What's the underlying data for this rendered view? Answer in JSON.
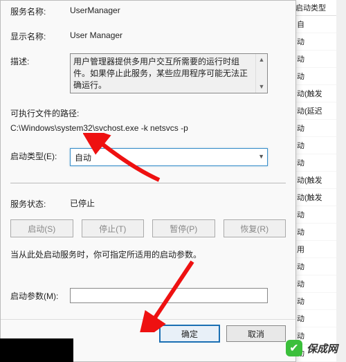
{
  "labels": {
    "service_name_label": "服务名称:",
    "display_name_label": "显示名称:",
    "desc_label": "描述:",
    "exe_path_label": "可执行文件的路径:",
    "startup_type_label": "启动类型(E):",
    "service_state_label": "服务状态:",
    "tip_text": "当从此处启动服务时，你可指定所适用的启动参数。",
    "start_params_label": "启动参数(M):"
  },
  "values": {
    "service_name": "UserManager",
    "display_name": "User Manager",
    "description": "用户管理器提供多用户交互所需要的运行时组件。如果停止此服务，某些应用程序可能无法正确运行。",
    "exe_path": "C:\\Windows\\system32\\svchost.exe -k netsvcs -p",
    "startup_type_selected": "自动",
    "service_state": "已停止",
    "start_params_value": ""
  },
  "buttons": {
    "start": "启动(S)",
    "stop": "停止(T)",
    "pause": "暂停(P)",
    "resume": "恢复(R)",
    "ok": "确定",
    "cancel": "取消"
  },
  "right_list": {
    "header": "启动类型",
    "rows": [
      "自",
      "动",
      "动",
      "动",
      "动(触发",
      "动(延迟",
      "动",
      "动",
      "动",
      "动(触发",
      "动(触发",
      "动",
      "动",
      "用",
      "动",
      "动",
      "动",
      "动",
      "动",
      "动"
    ]
  },
  "watermark_text": "保成网"
}
